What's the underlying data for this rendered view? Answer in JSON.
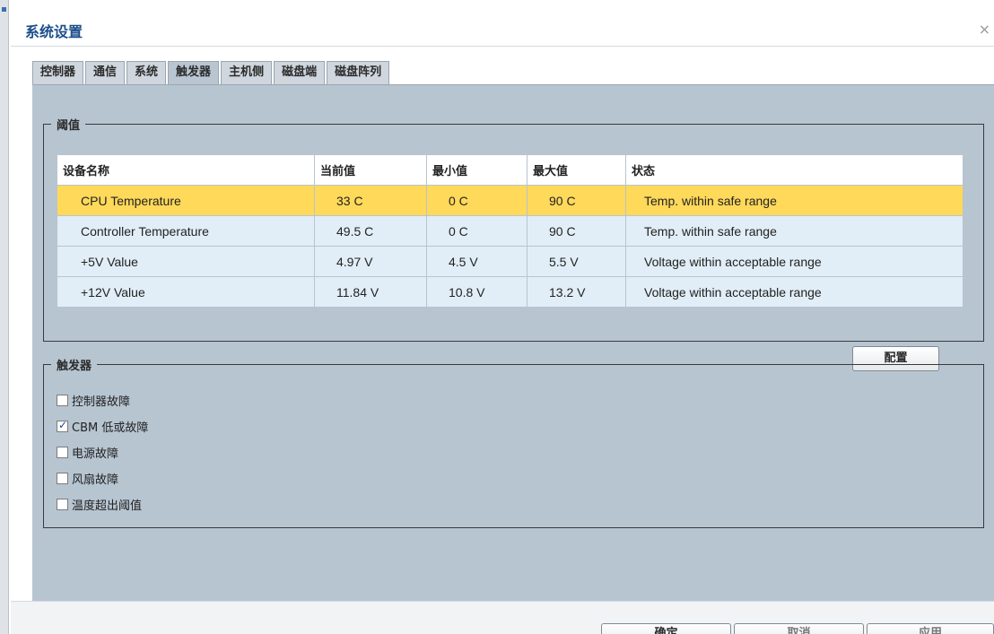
{
  "window": {
    "title": "系统设置",
    "close_label": "×"
  },
  "tabs": [
    {
      "label": "控制器"
    },
    {
      "label": "通信"
    },
    {
      "label": "系统"
    },
    {
      "label": "触发器"
    },
    {
      "label": "主机侧"
    },
    {
      "label": "磁盘端"
    },
    {
      "label": "磁盘阵列"
    }
  ],
  "active_tab": "触发器",
  "threshold": {
    "legend": "阈值",
    "columns": [
      "设备名称",
      "当前值",
      "最小值",
      "最大值",
      "状态"
    ],
    "rows": [
      {
        "name": "CPU Temperature",
        "current": "33 C",
        "min": "0 C",
        "max": "90 C",
        "status": "Temp. within safe range"
      },
      {
        "name": "Controller Temperature",
        "current": "49.5 C",
        "min": "0 C",
        "max": "90 C",
        "status": "Temp. within safe range"
      },
      {
        "name": "+5V Value",
        "current": "4.97 V",
        "min": "4.5 V",
        "max": "5.5 V",
        "status": "Voltage within acceptable range"
      },
      {
        "name": "+12V Value",
        "current": "11.84 V",
        "min": "10.8 V",
        "max": "13.2 V",
        "status": "Voltage within acceptable range"
      }
    ],
    "selected_row": "CPU Temperature",
    "config_label": "配置"
  },
  "trigger": {
    "legend": "触发器",
    "items": [
      {
        "label": "控制器故障",
        "checked": false
      },
      {
        "label": "CBM 低或故障",
        "checked": true
      },
      {
        "label": "电源故障",
        "checked": false
      },
      {
        "label": "风扇故障",
        "checked": false
      },
      {
        "label": "温度超出阈值",
        "checked": false
      }
    ]
  },
  "footer": {
    "ok_label": "确定",
    "cancel_label": "取消",
    "apply_label": "应用"
  },
  "colors": {
    "selected_row": "#ffd95a",
    "row_bg": "#e1eef7",
    "panel_bg": "#b7c5d1",
    "title": "#1b4e8a"
  }
}
